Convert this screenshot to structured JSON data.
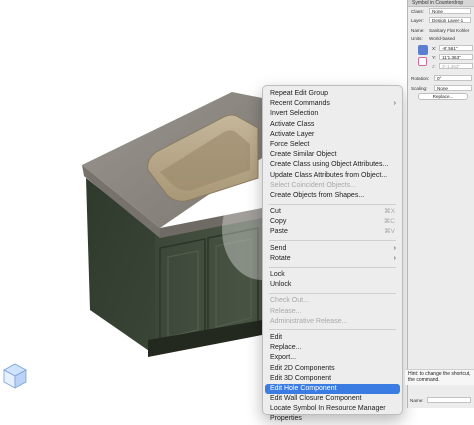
{
  "panel": {
    "header": "Symbol in Counterdrop",
    "class_label": "Class:",
    "class_value": "None",
    "layer_label": "Layer:",
    "layer_value": "Design Layer-1",
    "name_label": "Name:",
    "name_value": "Sanitary Flat Kohler",
    "units_label": "Units:",
    "units_value": "World-based",
    "x_label": "X:",
    "x_value": "-8'.561\"",
    "y_label": "Y:",
    "y_value": "11'1.363\"",
    "z_label": "Z:",
    "z_value": "3'-1.363\"",
    "rotation_label": "Rotation:",
    "rotation_value": "0°",
    "scaling_label": "Scaling:",
    "scaling_value": "None",
    "replace_label": "Replace...",
    "hint_text": "Hint: to change the shortcut, the command.",
    "name_field_label": "Name:"
  },
  "menu": {
    "items": [
      {
        "label": "Repeat Edit Group",
        "enabled": true
      },
      {
        "label": "Recent Commands",
        "enabled": true,
        "submenu": true
      },
      {
        "label": "Invert Selection",
        "enabled": true
      },
      {
        "label": "Activate Class",
        "enabled": true
      },
      {
        "label": "Activate Layer",
        "enabled": true
      },
      {
        "label": "Force Select",
        "enabled": true
      },
      {
        "label": "Create Similar Object",
        "enabled": true
      },
      {
        "label": "Create Class using Object Attributes...",
        "enabled": true
      },
      {
        "label": "Update Class Attributes from Object...",
        "enabled": true
      },
      {
        "label": "Select Coincident Objects...",
        "enabled": false
      },
      {
        "label": "Create Objects from Shapes...",
        "enabled": true
      },
      {
        "separator": true
      },
      {
        "label": "Cut",
        "enabled": true,
        "shortcut": "⌘X"
      },
      {
        "label": "Copy",
        "enabled": true,
        "shortcut": "⌘C"
      },
      {
        "label": "Paste",
        "enabled": true,
        "shortcut": "⌘V"
      },
      {
        "separator": true
      },
      {
        "label": "Send",
        "enabled": true,
        "submenu": true
      },
      {
        "label": "Rotate",
        "enabled": true,
        "submenu": true
      },
      {
        "separator": true
      },
      {
        "label": "Lock",
        "enabled": true
      },
      {
        "label": "Unlock",
        "enabled": true
      },
      {
        "separator": true
      },
      {
        "label": "Check Out...",
        "enabled": false
      },
      {
        "label": "Release...",
        "enabled": false
      },
      {
        "label": "Administrative Release...",
        "enabled": false
      },
      {
        "separator": true
      },
      {
        "label": "Edit",
        "enabled": true
      },
      {
        "label": "Replace...",
        "enabled": true
      },
      {
        "label": "Export...",
        "enabled": true
      },
      {
        "label": "Edit 2D Components",
        "enabled": true
      },
      {
        "label": "Edit 3D Component",
        "enabled": true
      },
      {
        "label": "Edit Hole Component",
        "enabled": true,
        "highlighted": true
      },
      {
        "label": "Edit Wall Closure Component",
        "enabled": true
      },
      {
        "label": "Locate Symbol In Resource Manager",
        "enabled": true
      },
      {
        "label": "Properties",
        "enabled": true
      }
    ]
  },
  "colors": {
    "cabinet": "#3f4a3b",
    "countertop": "#8f8a84",
    "sink": "#b3a287",
    "highlight": "#3b7ce3"
  }
}
